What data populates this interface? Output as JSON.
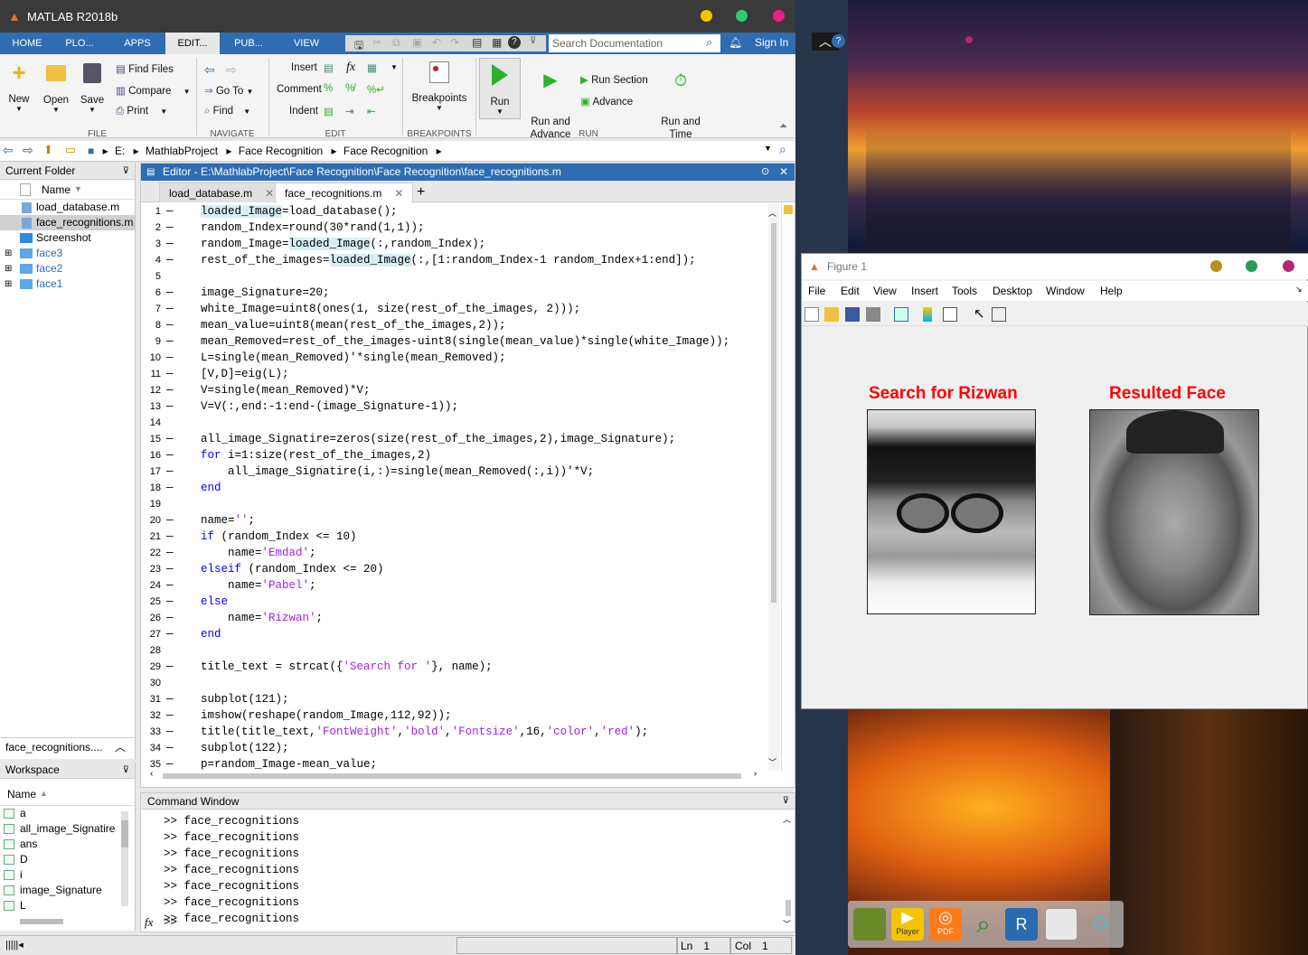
{
  "app": {
    "title": "MATLAB R2018b"
  },
  "tabs": [
    "HOME",
    "PLO...",
    "APPS",
    "EDIT...",
    "PUB...",
    "VIEW"
  ],
  "search": {
    "placeholder": "Search Documentation",
    "signin": "Sign In"
  },
  "toolstrip": {
    "file": {
      "section": "FILE",
      "new": "New",
      "open": "Open",
      "save": "Save",
      "find_files": "Find Files",
      "compare": "Compare",
      "print": "Print"
    },
    "navigate": {
      "section": "NAVIGATE",
      "goto": "Go To",
      "find": "Find"
    },
    "edit": {
      "section": "EDIT",
      "insert": "Insert",
      "comment": "Comment",
      "indent": "Indent"
    },
    "breakpoints": {
      "section": "BREAKPOINTS",
      "label": "Breakpoints"
    },
    "run": {
      "section": "RUN",
      "run": "Run",
      "run_advance": "Run and\nAdvance",
      "run_section": "Run Section",
      "advance": "Advance",
      "run_time": "Run and\nTime"
    }
  },
  "address": {
    "path": [
      "E:",
      "MathlabProject",
      "Face Recognition",
      "Face Recognition"
    ]
  },
  "current_folder": {
    "title": "Current Folder",
    "col": "Name",
    "items": [
      "load_database.m",
      "face_recognitions.m",
      "Screenshot",
      "face3",
      "face2",
      "face1"
    ],
    "details": "face_recognitions...."
  },
  "editor": {
    "title": "Editor - E:\\MathlabProject\\Face Recognition\\Face Recognition\\face_recognitions.m",
    "tabs": [
      "load_database.m",
      "face_recognitions.m"
    ]
  },
  "code_lines": [
    "loaded_Image=load_database();",
    "random_Index=round(30*rand(1,1));",
    "random_Image=loaded_Image(:,random_Index);",
    "rest_of_the_images=loaded_Image(:,[1:random_Index-1 random_Index+1:end]);",
    "",
    "image_Signature=20;",
    "white_Image=uint8(ones(1, size(rest_of_the_images, 2)));",
    "mean_value=uint8(mean(rest_of_the_images,2));",
    "mean_Removed=rest_of_the_images-uint8(single(mean_value)*single(white_Image));",
    "L=single(mean_Removed)'*single(mean_Removed);",
    "[V,D]=eig(L);",
    "V=single(mean_Removed)*V;",
    "V=V(:,end:-1:end-(image_Signature-1));",
    "",
    "all_image_Signatire=zeros(size(rest_of_the_images,2),image_Signature);",
    "for i=1:size(rest_of_the_images,2)",
    "    all_image_Signatire(i,:)=single(mean_Removed(:,i))'*V;",
    "end",
    "",
    "name='';",
    "if (random_Index <= 10)",
    "    name='Emdad';",
    "elseif (random_Index <= 20)",
    "    name='Pabel';",
    "else",
    "    name='Rizwan';",
    "end",
    "",
    "title_text = strcat({'Search for '}, name);",
    "",
    "subplot(121);",
    "imshow(reshape(random_Image,112,92));",
    "title(title_text,'FontWeight','bold','Fontsize',16,'color','red');",
    "subplot(122);",
    "p=random_Image-mean_value;"
  ],
  "command_window": {
    "title": "Command Window",
    "lines": [
      ">> face_recognitions",
      ">> face_recognitions",
      ">> face_recognitions",
      ">> face_recognitions",
      ">> face_recognitions",
      ">> face_recognitions",
      ">> face_recognitions"
    ],
    "prompt": ">>",
    "fx": "fx"
  },
  "workspace": {
    "title": "Workspace",
    "col": "Name",
    "vars": [
      "a",
      "all_image_Signatire",
      "ans",
      "D",
      "i",
      "image_Signature",
      "L"
    ]
  },
  "status": {
    "ln_label": "Ln",
    "ln": "1",
    "col_label": "Col",
    "col": "1"
  },
  "figure": {
    "title": "Figure 1",
    "menu": [
      "File",
      "Edit",
      "View",
      "Insert",
      "Tools",
      "Desktop",
      "Window",
      "Help"
    ],
    "left_title": "Search for Rizwan",
    "right_title": "Resulted Face"
  },
  "dock": {
    "player": "Player",
    "pdf": "PDF"
  },
  "colors": {
    "matlab_blue": "#2e6db1",
    "title_red": "#ff0000",
    "string_purple": "#a020f0",
    "keyword_blue": "#0000ff"
  }
}
